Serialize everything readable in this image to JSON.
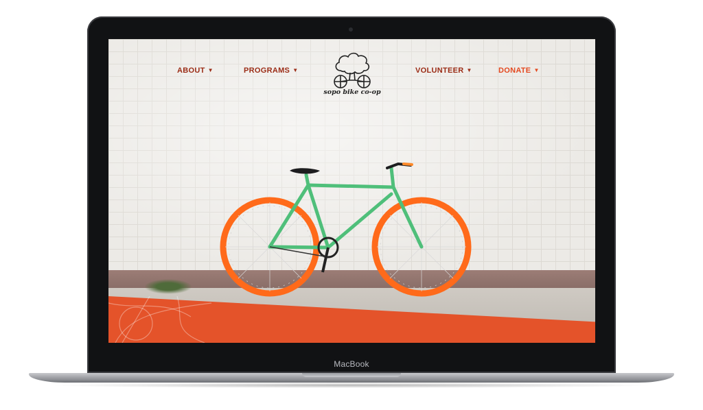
{
  "device": {
    "brand_label": "MacBook"
  },
  "site": {
    "logo_text": "sopo bike co-op",
    "nav": {
      "about": "ABOUT",
      "programs": "PROGRAMS",
      "volunteer": "VOLUNTEER",
      "donate": "DONATE",
      "dropdown_icon": "chevron-down-icon"
    },
    "hero": {
      "image_subject": "green-bicycle-with-orange-wheels-against-white-brick-wall"
    }
  },
  "colors": {
    "nav_text": "#9b2c16",
    "donate_text": "#e4481f",
    "accent_band": "#e4532a",
    "bike_frame": "#4fbf7a",
    "bike_wheels": "#ff6a1a",
    "bezel": "#111214"
  }
}
